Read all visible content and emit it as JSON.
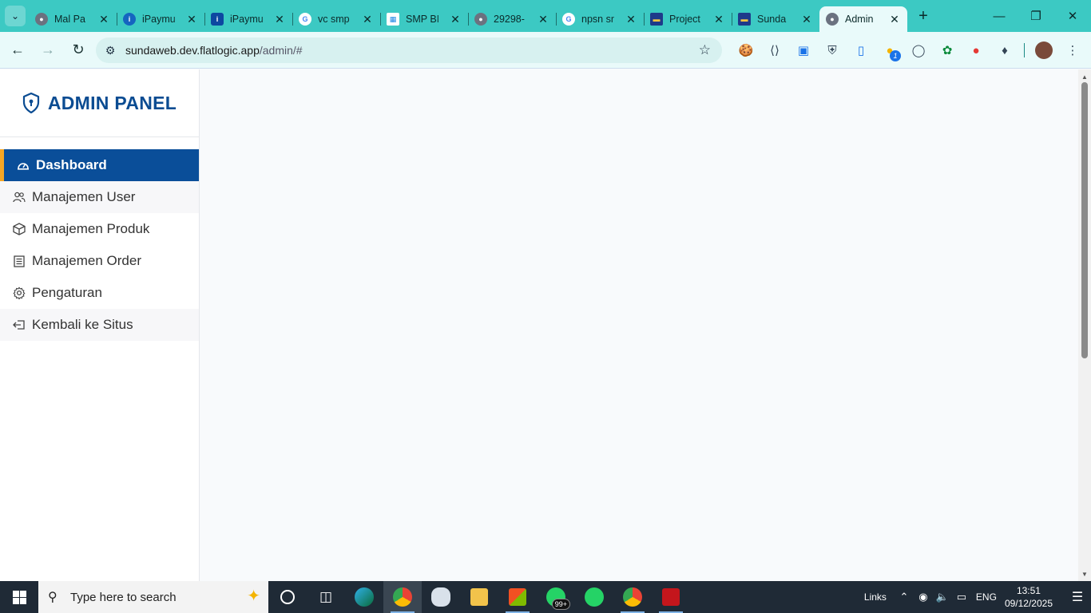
{
  "browser": {
    "tabs": [
      {
        "title": "Mal Pa",
        "icon": "globe-icon",
        "color": "#5f6368"
      },
      {
        "title": "iPaymu",
        "icon": "ipaymu-icon",
        "color": "#1565c0"
      },
      {
        "title": "iPaymu",
        "icon": "ipaymu-icon",
        "color": "#0d47a1"
      },
      {
        "title": "vc smp",
        "icon": "google-icon",
        "color": "#ffffff"
      },
      {
        "title": "SMP BI",
        "icon": "sheet-icon",
        "color": "#ffffff"
      },
      {
        "title": "29298-",
        "icon": "globe-icon",
        "color": "#5f6368"
      },
      {
        "title": "npsn sr",
        "icon": "google-icon",
        "color": "#ffffff"
      },
      {
        "title": "Project",
        "icon": "flatlogic-icon",
        "color": "#1e3a8a"
      },
      {
        "title": "Sunda",
        "icon": "flatlogic-icon",
        "color": "#1e3a8a"
      },
      {
        "title": "Admin",
        "icon": "globe-icon",
        "color": "#5f6368",
        "active": true
      }
    ],
    "url_host": "sundaweb.dev.flatlogic.app",
    "url_path": "/admin/#"
  },
  "sidebar": {
    "brand": "ADMIN PANEL",
    "items": [
      {
        "label": "Dashboard",
        "icon": "dashboard-icon"
      },
      {
        "label": "Manajemen User",
        "icon": "users-icon"
      },
      {
        "label": "Manajemen Produk",
        "icon": "box-icon"
      },
      {
        "label": "Manajemen Order",
        "icon": "list-icon"
      },
      {
        "label": "Pengaturan",
        "icon": "gear-icon"
      },
      {
        "label": "Kembali ke Situs",
        "icon": "back-icon"
      }
    ]
  },
  "taskbar": {
    "search_placeholder": "Type here to search",
    "whatsapp_badge": "99+",
    "links_label": "Links",
    "language": "ENG",
    "time": "13:51",
    "date": "09/12/2025"
  },
  "colors": {
    "tabstrip": "#3cc9c3",
    "brand": "#0b4c92",
    "active_menu": "#0a4e99",
    "active_accent": "#f5a623"
  }
}
